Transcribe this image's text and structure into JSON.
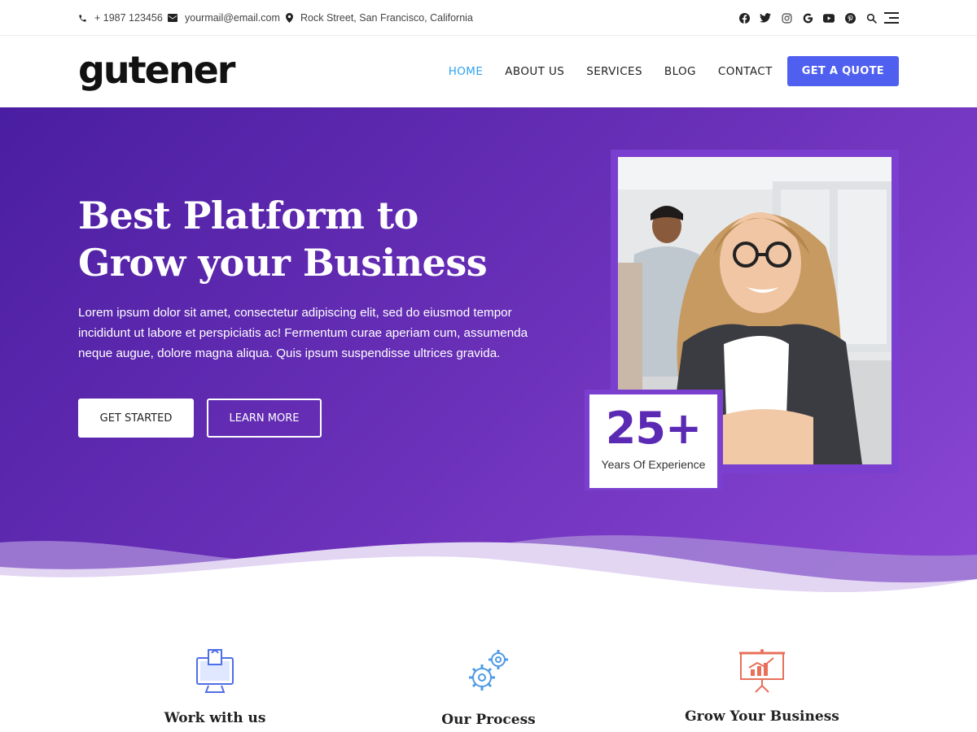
{
  "topbar": {
    "phone": "+ 1987 123456",
    "email": "yourmail@email.com",
    "address": "Rock Street, San Francisco, California",
    "social_icons": [
      "facebook-icon",
      "twitter-icon",
      "instagram-icon",
      "google-icon",
      "youtube-icon",
      "pinterest-icon",
      "search-icon"
    ]
  },
  "header": {
    "logo": "gutener",
    "nav": [
      "HOME",
      "ABOUT US",
      "SERVICES",
      "BLOG",
      "CONTACT"
    ],
    "active_nav": "HOME",
    "cta": "GET A QUOTE"
  },
  "hero": {
    "title": "Best Platform to Grow your Business",
    "text": "Lorem ipsum dolor sit amet, consectetur adipiscing elit, sed do eiusmod tempor incididunt ut labore et perspiciatis ac! Fermentum curae aperiam cum, assumenda neque augue, dolore magna aliqua. Quis ipsum suspendisse ultrices gravida.",
    "primary_button": "GET STARTED",
    "secondary_button": "LEARN MORE",
    "experience_number": "25+",
    "experience_label": "Years Of Experience"
  },
  "features": [
    {
      "title": "Work with us",
      "icon": "monitor-shopping-bag-icon"
    },
    {
      "title": "Our Process",
      "icon": "gears-icon"
    },
    {
      "title": "Grow Your Business",
      "icon": "presentation-chart-icon"
    }
  ],
  "colors": {
    "accent": "#4f5ff0",
    "active_link": "#2ea3f2",
    "hero_gradient_start": "#4a1ea1",
    "hero_gradient_end": "#8c48d6",
    "experience_number": "#5b2ab4"
  }
}
